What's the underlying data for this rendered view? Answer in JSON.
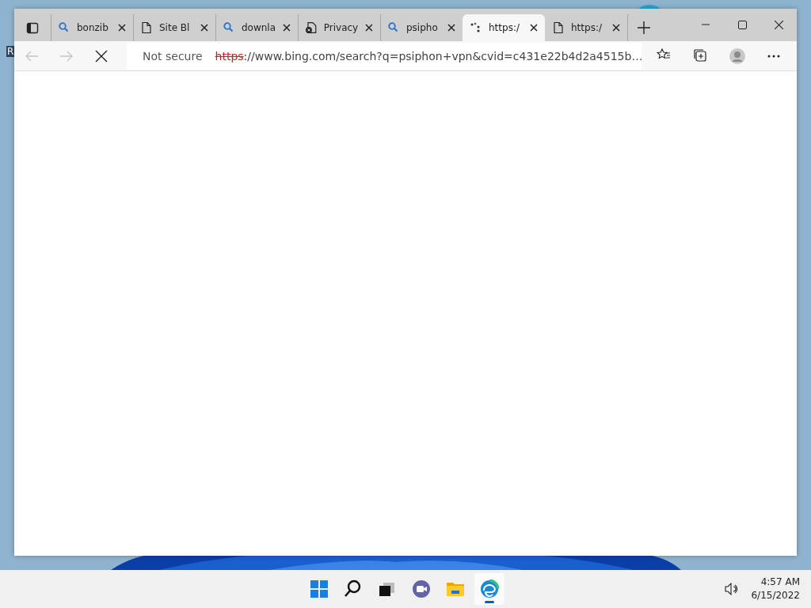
{
  "desktop": {
    "icon_label": "R"
  },
  "browser": {
    "tabs": [
      {
        "kind": "search",
        "title": "bonzib",
        "selected": false
      },
      {
        "kind": "page",
        "title": "Site Bl",
        "selected": false
      },
      {
        "kind": "search",
        "title": "downla",
        "selected": false
      },
      {
        "kind": "blocked",
        "title": "Privacy",
        "selected": false
      },
      {
        "kind": "search",
        "title": "psipho",
        "selected": false
      },
      {
        "kind": "loading",
        "title": "https:/",
        "selected": true
      },
      {
        "kind": "page",
        "title": "https:/",
        "selected": false
      }
    ],
    "address_bar": {
      "security": "Not secure",
      "scheme": "https",
      "rest": "://www.bing.com/search?q=psiphon+vpn&cvid=c431e22b4d2a4515b…"
    },
    "loading": true
  },
  "taskbar": {
    "apps": [
      {
        "kind": "start",
        "active": false
      },
      {
        "kind": "search",
        "active": false
      },
      {
        "kind": "taskview",
        "active": false
      },
      {
        "kind": "chat",
        "active": false
      },
      {
        "kind": "explorer",
        "active": false
      },
      {
        "kind": "edge",
        "active": true
      }
    ],
    "time": "4:57 AM",
    "date": "6/15/2022"
  }
}
